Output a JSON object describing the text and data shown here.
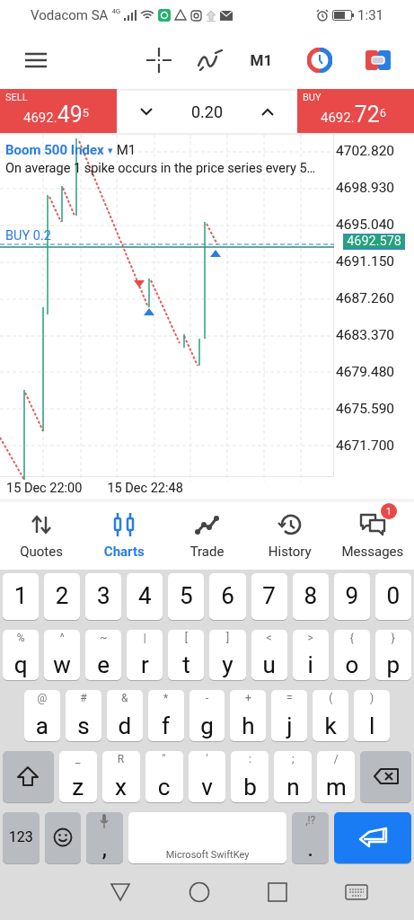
{
  "status_bar": {
    "carrier": "Vodacom SA",
    "network": "4G",
    "time": "1:31"
  },
  "toolbar": {
    "timeframe": "M1"
  },
  "trade_bar": {
    "sell": {
      "label": "SELL",
      "price_main": "4692.",
      "price_big": "49",
      "price_sup": "5"
    },
    "volume": "0.20",
    "buy": {
      "label": "BUY",
      "price_main": "4692.",
      "price_big": "72",
      "price_sup": "6"
    }
  },
  "chart": {
    "symbol": "Boom 500 Index",
    "dropdown": "▾",
    "timeframe": "M1",
    "description": "On average 1 spike occurs in the price series every 5…",
    "position_label": "BUY 0.2",
    "current_price": "4692.578",
    "price_ticks": [
      "4702.820",
      "4698.930",
      "4695.040",
      "4691.150",
      "4687.260",
      "4683.370",
      "4679.480",
      "4675.590",
      "4671.700"
    ],
    "time_ticks": [
      "15 Dec 22:00",
      "15 Dec 22:48"
    ]
  },
  "bottom_nav": [
    {
      "kind": "quotes",
      "label": "Quotes",
      "selected": false
    },
    {
      "kind": "charts",
      "label": "Charts",
      "selected": true
    },
    {
      "kind": "trade",
      "label": "Trade",
      "selected": false
    },
    {
      "kind": "history",
      "label": "History",
      "selected": false
    },
    {
      "kind": "messages",
      "label": "Messages",
      "selected": false,
      "badge": "1"
    }
  ],
  "keyboard": {
    "rows": [
      [
        {
          "label": "1"
        },
        {
          "label": "2"
        },
        {
          "label": "3"
        },
        {
          "label": "4"
        },
        {
          "label": "5"
        },
        {
          "label": "6"
        },
        {
          "label": "7"
        },
        {
          "label": "8"
        },
        {
          "label": "9"
        },
        {
          "label": "0"
        }
      ],
      [
        {
          "label": "q",
          "hint": "%"
        },
        {
          "label": "w",
          "hint": "^"
        },
        {
          "label": "e",
          "hint": "~"
        },
        {
          "label": "r",
          "hint": "|"
        },
        {
          "label": "t",
          "hint": "["
        },
        {
          "label": "y",
          "hint": "]"
        },
        {
          "label": "u",
          "hint": "<"
        },
        {
          "label": "i",
          "hint": ">"
        },
        {
          "label": "o",
          "hint": "{"
        },
        {
          "label": "p",
          "hint": "}"
        }
      ],
      [
        {
          "label": "a",
          "hint": "@"
        },
        {
          "label": "s",
          "hint": "#"
        },
        {
          "label": "d",
          "hint": "&"
        },
        {
          "label": "f",
          "hint": "*"
        },
        {
          "label": "g",
          "hint": "-"
        },
        {
          "label": "h",
          "hint": "+"
        },
        {
          "label": "j",
          "hint": "="
        },
        {
          "label": "k",
          "hint": "("
        },
        {
          "label": "l",
          "hint": ")"
        }
      ],
      [
        {
          "kind": "shift"
        },
        {
          "label": "z",
          "hint": "_"
        },
        {
          "label": "x",
          "hint": "R"
        },
        {
          "label": "c",
          "hint": "\""
        },
        {
          "label": "v",
          "hint": "'"
        },
        {
          "label": "b",
          "hint": ":"
        },
        {
          "label": "n",
          "hint": ";"
        },
        {
          "label": "m",
          "hint": "/"
        },
        {
          "kind": "backspace"
        }
      ],
      [
        {
          "kind": "mode",
          "label": "123"
        },
        {
          "kind": "emoji"
        },
        {
          "kind": "comma",
          "label": ","
        },
        {
          "kind": "space",
          "label": "Microsoft SwiftKey"
        },
        {
          "kind": "period",
          "label": ".",
          "hint": ",!?"
        },
        {
          "kind": "enter"
        }
      ]
    ]
  }
}
